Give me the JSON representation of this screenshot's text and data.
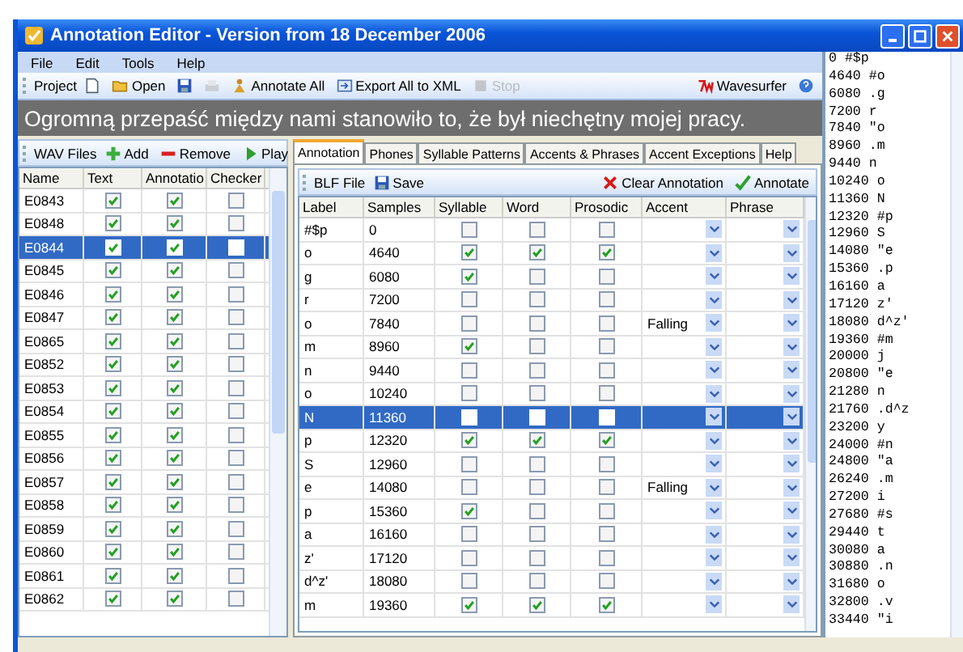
{
  "window": {
    "title": "Annotation Editor - Version from 18 December 2006"
  },
  "menu": [
    "File",
    "Edit",
    "Tools",
    "Help"
  ],
  "toolbar": {
    "label": "Project",
    "items": [
      {
        "kind": "new",
        "disabled": false
      },
      {
        "kind": "open",
        "label": "Open",
        "disabled": false
      },
      {
        "kind": "save",
        "disabled": false
      },
      {
        "kind": "print",
        "disabled": true
      },
      {
        "kind": "annotate",
        "label": "Annotate All",
        "disabled": false
      },
      {
        "kind": "export",
        "label": "Export All to XML",
        "disabled": false
      },
      {
        "kind": "stop",
        "label": "Stop",
        "disabled": true
      }
    ],
    "right": [
      {
        "kind": "wavesurfer",
        "label": "Wavesurfer",
        "disabled": false
      },
      {
        "kind": "help",
        "disabled": false
      }
    ]
  },
  "sentence": "Ogromną przepaść między nami stanowiło to, że był niechętny mojej pracy.",
  "files_panel": {
    "title": "WAV Files",
    "actions": [
      {
        "kind": "add",
        "label": "Add"
      },
      {
        "kind": "remove",
        "label": "Remove"
      },
      {
        "kind": "play",
        "label": "Play"
      }
    ],
    "columns": [
      "Name",
      "Text",
      "Annotatio",
      "Checker"
    ],
    "rows": [
      {
        "name": "E0843",
        "text": true,
        "annotation": true,
        "checked": false,
        "selected": false
      },
      {
        "name": "E0848",
        "text": true,
        "annotation": true,
        "checked": false,
        "selected": false
      },
      {
        "name": "E0844",
        "text": true,
        "annotation": true,
        "checked": false,
        "selected": true
      },
      {
        "name": "E0845",
        "text": true,
        "annotation": true,
        "checked": false,
        "selected": false
      },
      {
        "name": "E0846",
        "text": true,
        "annotation": true,
        "checked": false,
        "selected": false
      },
      {
        "name": "E0847",
        "text": true,
        "annotation": true,
        "checked": false,
        "selected": false
      },
      {
        "name": "E0865",
        "text": true,
        "annotation": true,
        "checked": false,
        "selected": false
      },
      {
        "name": "E0852",
        "text": true,
        "annotation": true,
        "checked": false,
        "selected": false
      },
      {
        "name": "E0853",
        "text": true,
        "annotation": true,
        "checked": false,
        "selected": false
      },
      {
        "name": "E0854",
        "text": true,
        "annotation": true,
        "checked": false,
        "selected": false
      },
      {
        "name": "E0855",
        "text": true,
        "annotation": true,
        "checked": false,
        "selected": false
      },
      {
        "name": "E0856",
        "text": true,
        "annotation": true,
        "checked": false,
        "selected": false
      },
      {
        "name": "E0857",
        "text": true,
        "annotation": true,
        "checked": false,
        "selected": false
      },
      {
        "name": "E0858",
        "text": true,
        "annotation": true,
        "checked": false,
        "selected": false
      },
      {
        "name": "E0859",
        "text": true,
        "annotation": true,
        "checked": false,
        "selected": false
      },
      {
        "name": "E0860",
        "text": true,
        "annotation": true,
        "checked": false,
        "selected": false
      },
      {
        "name": "E0861",
        "text": true,
        "annotation": true,
        "checked": false,
        "selected": false
      },
      {
        "name": "E0862",
        "text": true,
        "annotation": true,
        "checked": false,
        "selected": false
      }
    ]
  },
  "annotation_panel": {
    "tabs": [
      {
        "label": "Annotation",
        "selected": true
      },
      {
        "label": "Phones",
        "selected": false
      },
      {
        "label": "Syllable Patterns",
        "selected": false
      },
      {
        "label": "Accents & Phrases",
        "selected": false
      },
      {
        "label": "Accent Exceptions",
        "selected": false
      },
      {
        "label": "Help",
        "selected": false
      }
    ],
    "toolbar": {
      "label": "BLF File",
      "actions": [
        {
          "kind": "save",
          "label": "Save"
        },
        {
          "kind": "clear",
          "label": "Clear Annotation"
        },
        {
          "kind": "annotate",
          "label": "Annotate"
        }
      ]
    },
    "columns": [
      "Label",
      "Samples",
      "Syllable",
      "Word",
      "Prosodic",
      "Accent",
      "Phrase"
    ],
    "rows": [
      {
        "label": "#$p",
        "samples": "0",
        "syllable": false,
        "word": false,
        "prosodic": false,
        "selected": false
      },
      {
        "label": "o",
        "samples": "4640",
        "syllable": true,
        "word": true,
        "prosodic": true,
        "selected": false
      },
      {
        "label": "g",
        "samples": "6080",
        "syllable": true,
        "word": false,
        "prosodic": false,
        "selected": false
      },
      {
        "label": "r",
        "samples": "7200",
        "syllable": false,
        "word": false,
        "prosodic": false,
        "selected": false
      },
      {
        "label": "o",
        "samples": "7840",
        "syllable": false,
        "word": false,
        "prosodic": false,
        "accent": "Falling",
        "selected": false
      },
      {
        "label": "m",
        "samples": "8960",
        "syllable": true,
        "word": false,
        "prosodic": false,
        "selected": false
      },
      {
        "label": "n",
        "samples": "9440",
        "syllable": false,
        "word": false,
        "prosodic": false,
        "selected": false
      },
      {
        "label": "o",
        "samples": "10240",
        "syllable": false,
        "word": false,
        "prosodic": false,
        "selected": false
      },
      {
        "label": "N",
        "samples": "11360",
        "syllable": false,
        "word": false,
        "prosodic": false,
        "selected": true
      },
      {
        "label": "p",
        "samples": "12320",
        "syllable": true,
        "word": true,
        "prosodic": true,
        "selected": false
      },
      {
        "label": "S",
        "samples": "12960",
        "syllable": false,
        "word": false,
        "prosodic": false,
        "selected": false
      },
      {
        "label": "e",
        "samples": "14080",
        "syllable": false,
        "word": false,
        "prosodic": false,
        "accent": "Falling",
        "selected": false
      },
      {
        "label": "p",
        "samples": "15360",
        "syllable": true,
        "word": false,
        "prosodic": false,
        "selected": false
      },
      {
        "label": "a",
        "samples": "16160",
        "syllable": false,
        "word": false,
        "prosodic": false,
        "selected": false
      },
      {
        "label": "z'",
        "samples": "17120",
        "syllable": false,
        "word": false,
        "prosodic": false,
        "selected": false
      },
      {
        "label": "d^z'",
        "samples": "18080",
        "syllable": false,
        "word": false,
        "prosodic": false,
        "selected": false
      },
      {
        "label": "m",
        "samples": "19360",
        "syllable": true,
        "word": true,
        "prosodic": true,
        "selected": false
      }
    ]
  },
  "text_panel": {
    "lines": [
      "0 #$p",
      "4640 #o",
      "6080 .g",
      "7200 r",
      "7840 \"o",
      "8960 .m",
      "9440 n",
      "10240 o",
      "11360 N",
      "12320 #p",
      "12960 S",
      "14080 \"e",
      "15360 .p",
      "16160 a",
      "17120 z'",
      "18080 d^z'",
      "19360 #m",
      "20000 j",
      "20800 \"e",
      "21280 n",
      "21760 .d^z",
      "23200 y",
      "24000 #n",
      "24800 \"a",
      "26240 .m",
      "27200 i",
      "27680 #s",
      "29440 t",
      "30080 a",
      "30880 .n",
      "31680 o",
      "32800 .v",
      "33440 \"i"
    ]
  }
}
